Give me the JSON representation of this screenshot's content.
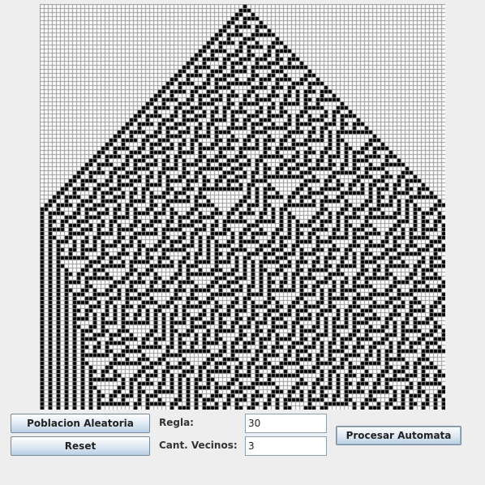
{
  "controls": {
    "random_population_label": "Poblacion Aleatoria",
    "reset_label": "Reset",
    "rule_label": "Regla:",
    "rule_value": "30",
    "neighbors_label": "Cant. Vecinos:",
    "neighbors_value": "3",
    "process_label": "Procesar Automata"
  },
  "automaton": {
    "rule": 30,
    "neighbors": 3,
    "columns": 100,
    "rows": 100,
    "initial_state": "single-center-cell",
    "boundary": "fixed-zero",
    "colors": {
      "alive": "#000000",
      "dead": "#ffffff",
      "gridline": "#999999"
    }
  }
}
